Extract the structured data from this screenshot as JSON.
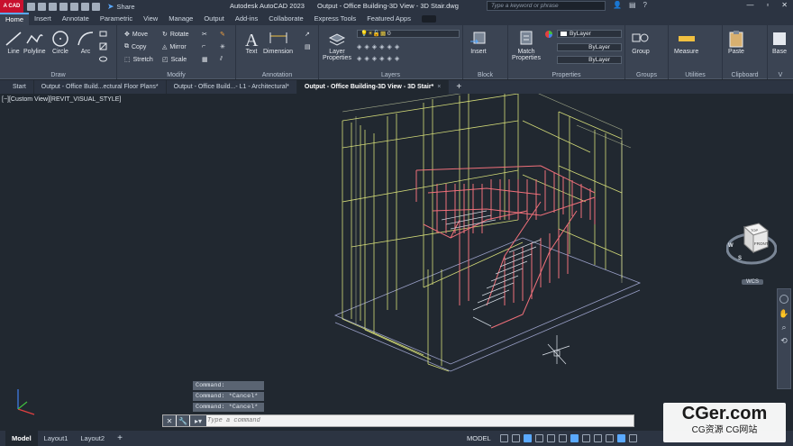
{
  "app": {
    "logo": "A CAD",
    "title": "Autodesk AutoCAD 2023",
    "file": "Output - Office Building-3D View - 3D Stair.dwg",
    "share": "Share"
  },
  "search": {
    "placeholder": "Type a keyword or phrase"
  },
  "menu_tabs": [
    "Home",
    "Insert",
    "Annotate",
    "Parametric",
    "View",
    "Manage",
    "Output",
    "Add-ins",
    "Collaborate",
    "Express Tools",
    "Featured Apps"
  ],
  "ribbon": {
    "draw": {
      "label": "Draw",
      "line": "Line",
      "polyline": "Polyline",
      "circle": "Circle",
      "arc": "Arc"
    },
    "modify": {
      "label": "Modify",
      "move": "Move",
      "rotate": "Rotate",
      "copy": "Copy",
      "mirror": "Mirror",
      "stretch": "Stretch",
      "scale": "Scale"
    },
    "annotation": {
      "label": "Annotation",
      "text": "Text",
      "dimension": "Dimension"
    },
    "layers": {
      "label": "Layers",
      "layer_properties": "Layer Properties",
      "current_layer": "0"
    },
    "block": {
      "label": "Block",
      "insert": "Insert"
    },
    "properties": {
      "label": "Properties",
      "match": "Match Properties",
      "color": "ByLayer",
      "linetype": "ByLayer",
      "lineweight": "ByLayer"
    },
    "groups": {
      "label": "Groups",
      "group": "Group"
    },
    "utilities": {
      "label": "Utilities",
      "measure": "Measure"
    },
    "clipboard": {
      "label": "Clipboard",
      "paste": "Paste"
    },
    "view": {
      "label": "V",
      "base": "Base"
    }
  },
  "doc_tabs": [
    "Start",
    "Output - Office Build...ectural Floor Plans*",
    "Output - Office Build...- L1 - Architectural*",
    "Output - Office Building-3D View - 3D Stair*"
  ],
  "viewport": {
    "label": "[−][Custom View][REVIT_VISUAL_STYLE]",
    "cube_top": "TOP",
    "cube_front": "FRONT",
    "compass_w": "W",
    "compass_s": "S",
    "wcs": "WCS"
  },
  "command": {
    "history": [
      "Command:",
      "Command: *Cancel*",
      "Command: *Cancel*"
    ],
    "placeholder": "Type a command"
  },
  "status": {
    "tabs": [
      "Model",
      "Layout1",
      "Layout2"
    ],
    "space": "MODEL"
  },
  "watermark": {
    "line1": "CGer.com",
    "line2": "CG资源 CG网站"
  },
  "colors": {
    "stair": "#f0707a",
    "walls": "#e8f080",
    "edges": "#d8e0b0",
    "accent": "#5aa9ff"
  }
}
